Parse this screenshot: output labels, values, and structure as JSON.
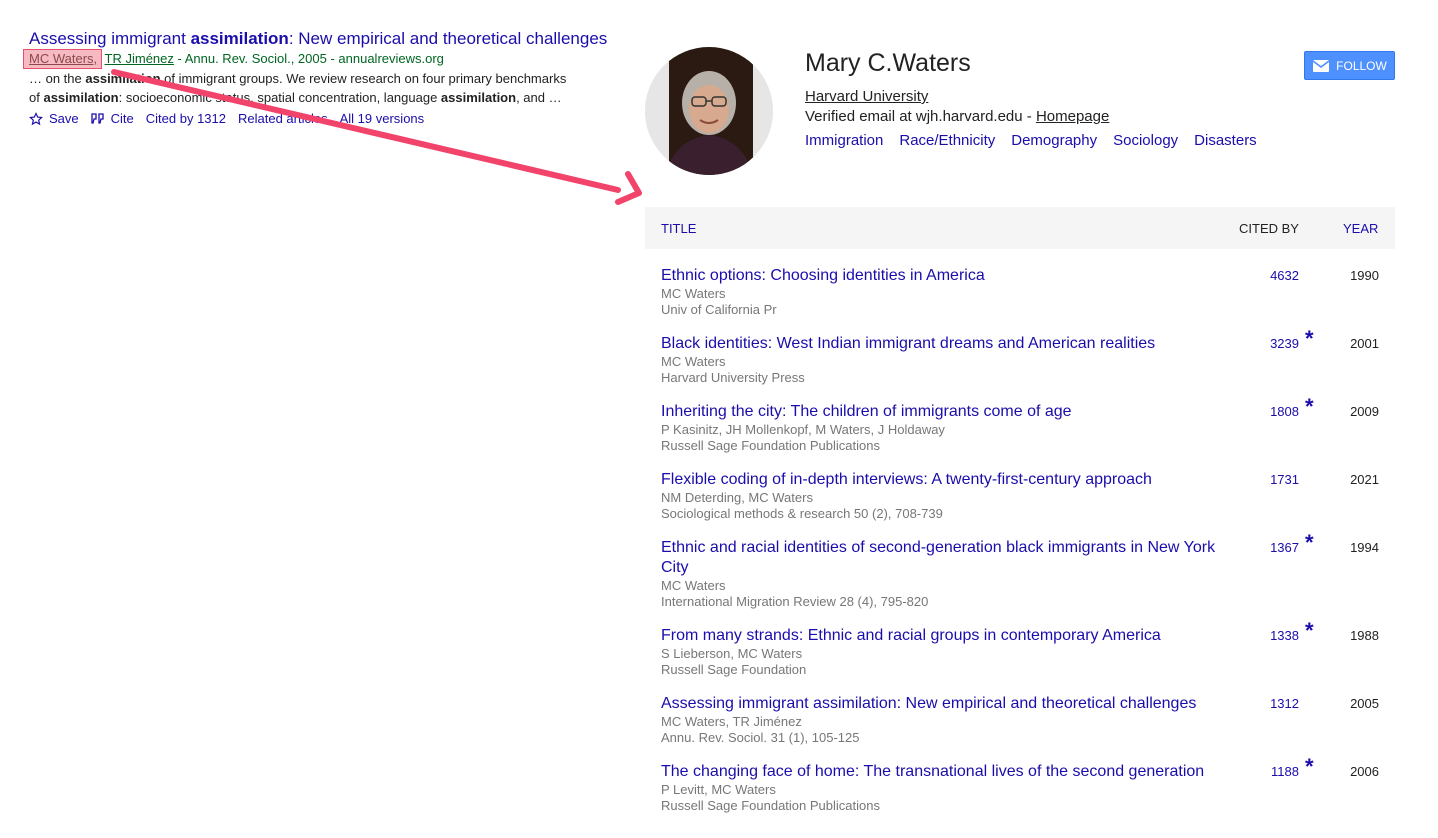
{
  "result": {
    "title_parts": [
      "Assessing immigrant ",
      "assimilation",
      ": New empirical and theoretical challenges"
    ],
    "author1": "MC Waters,",
    "author2": "TR Jiménez",
    "source": " - Annu. Rev. Sociol., 2005 - annualreviews.org",
    "snippet1_parts": [
      "… on the ",
      "assimilation",
      " of immigrant groups. We review research on four primary benchmarks"
    ],
    "snippet2_parts": [
      "of ",
      "assimilation",
      ": socioeconomic status, spatial concentration, language ",
      "assimilation",
      ", and …"
    ],
    "links": {
      "save": "Save",
      "cite": "Cite",
      "cited_by": "Cited by 1312",
      "related": "Related articles",
      "versions": "All 19 versions"
    }
  },
  "annotation": {
    "color": "#f2436a"
  },
  "profile": {
    "name": "Mary C.Waters",
    "affiliation": "Harvard University",
    "email_prefix": "Verified email at wjh.harvard.edu - ",
    "homepage": "Homepage",
    "interests": [
      "Immigration",
      "Race/Ethnicity",
      "Demography",
      "Sociology",
      "Disasters"
    ],
    "follow_label": "FOLLOW"
  },
  "table": {
    "headers": {
      "title": "TITLE",
      "cited_by": "CITED BY",
      "year": "YEAR"
    },
    "rows": [
      {
        "title": "Ethnic options: Choosing identities in America",
        "authors": "MC Waters",
        "venue": "Univ of California Pr",
        "cited": "4632",
        "star": "",
        "year": "1990"
      },
      {
        "title": "Black identities: West Indian immigrant dreams and American realities",
        "authors": "MC Waters",
        "venue": "Harvard University Press",
        "cited": "3239",
        "star": "*",
        "year": "2001"
      },
      {
        "title": "Inheriting the city: The children of immigrants come of age",
        "authors": "P Kasinitz, JH Mollenkopf, M Waters, J Holdaway",
        "venue": "Russell Sage Foundation Publications",
        "cited": "1808",
        "star": "*",
        "year": "2009"
      },
      {
        "title": "Flexible coding of in-depth interviews: A twenty-first-century approach",
        "authors": "NM Deterding, MC Waters",
        "venue": "Sociological methods & research 50 (2), 708-739",
        "cited": "1731",
        "star": "",
        "year": "2021"
      },
      {
        "title": "Ethnic and racial identities of second-generation black immigrants in New York City",
        "authors": "MC Waters",
        "venue": "International Migration Review 28 (4), 795-820",
        "cited": "1367",
        "star": "*",
        "year": "1994"
      },
      {
        "title": "From many strands: Ethnic and racial groups in contemporary America",
        "authors": "S Lieberson, MC Waters",
        "venue": "Russell Sage Foundation",
        "cited": "1338",
        "star": "*",
        "year": "1988"
      },
      {
        "title": "Assessing immigrant assimilation: New empirical and theoretical challenges",
        "authors": "MC Waters, TR Jiménez",
        "venue": "Annu. Rev. Sociol. 31 (1), 105-125",
        "cited": "1312",
        "star": "",
        "year": "2005"
      },
      {
        "title": "The changing face of home: The transnational lives of the second generation",
        "authors": "P Levitt, MC Waters",
        "venue": "Russell Sage Foundation Publications",
        "cited": "1188",
        "star": "*",
        "year": "2006"
      }
    ]
  }
}
